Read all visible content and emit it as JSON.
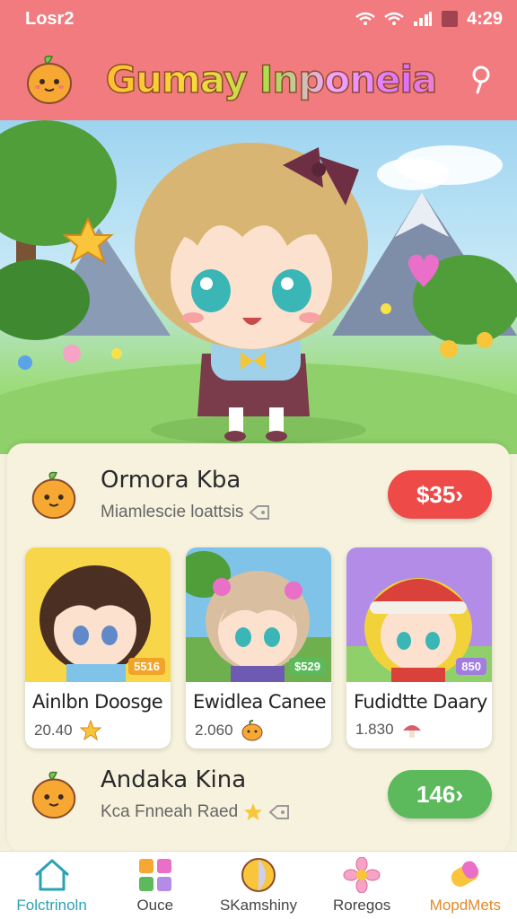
{
  "status": {
    "carrier": "Losr2",
    "time": "4:29"
  },
  "header": {
    "title": "Gumay Inponeia"
  },
  "featured": [
    {
      "name": "Ormora Kba",
      "subtitle": "Miamlescie loattsis",
      "price": "$35›",
      "accent": "#ee4b48"
    },
    {
      "name": "Andaka Kina",
      "subtitle": "Kca Fnneah Raed",
      "price": "146›",
      "accent": "#5cb95c"
    }
  ],
  "cards": [
    {
      "name": "Ainlbn Doosge",
      "value": "20.40",
      "tag": "5516",
      "bg": "#f8d64a",
      "tag_bg": "#f0a42a"
    },
    {
      "name": "Ewidlea Canee",
      "value": "2.060",
      "tag": "$529",
      "bg": "#7fc3e8",
      "tag_bg": "#5cb95c"
    },
    {
      "name": "Fudidtte Daary",
      "value": "1.830",
      "tag": "850",
      "bg": "#b38ce8",
      "tag_bg": "#a27de0"
    }
  ],
  "nav": [
    {
      "label": "Folctrinoln",
      "icon": "home-icon"
    },
    {
      "label": "Ouce",
      "icon": "grid-icon"
    },
    {
      "label": "SKamshiny",
      "icon": "ball-icon"
    },
    {
      "label": "Roregos",
      "icon": "flower-icon"
    },
    {
      "label": "MopdMets",
      "icon": "candy-icon"
    }
  ]
}
